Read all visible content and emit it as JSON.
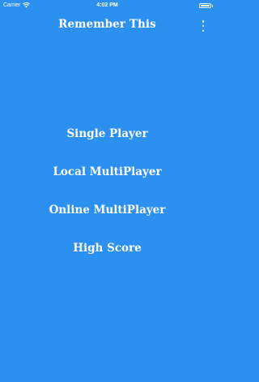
{
  "status_bar": {
    "carrier": "Carrier",
    "time": "4:02 PM",
    "wifi_icon": "wifi-icon",
    "battery_icon": "battery-icon",
    "battery_level": 1.0
  },
  "nav": {
    "title": "Remember This",
    "menu_icon": "vertical-ellipsis-icon"
  },
  "menu": {
    "single_player": "Single Player",
    "local_multiplayer": "Local MultiPlayer",
    "online_multiplayer": "Online MultiPlayer",
    "high_score": "High Score"
  },
  "colors": {
    "background": "#2b90ef",
    "text": "#ffffff"
  }
}
